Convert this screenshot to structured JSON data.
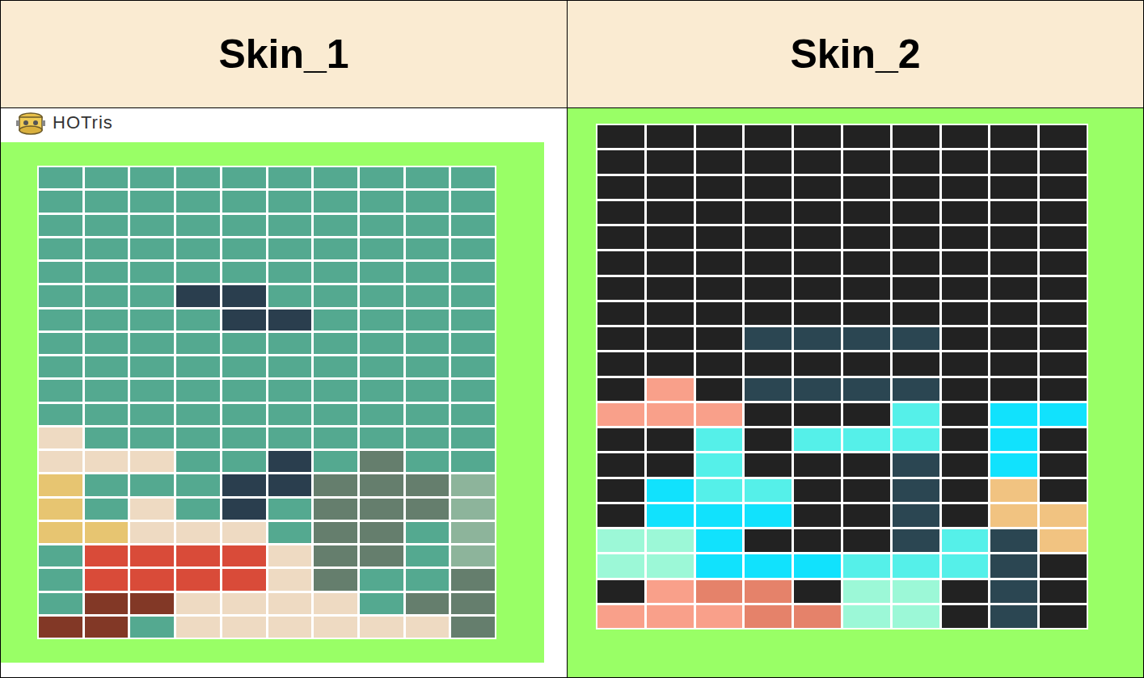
{
  "columns": [
    {
      "label": "Skin_1",
      "kind": "window",
      "window": {
        "title": "HOTris"
      },
      "board": {
        "rows": [
          [
            "#54a990",
            "#54a990",
            "#54a990",
            "#54a990",
            "#54a990",
            "#54a990",
            "#54a990",
            "#54a990",
            "#54a990",
            "#54a990"
          ],
          [
            "#54a990",
            "#54a990",
            "#54a990",
            "#54a990",
            "#54a990",
            "#54a990",
            "#54a990",
            "#54a990",
            "#54a990",
            "#54a990"
          ],
          [
            "#54a990",
            "#54a990",
            "#54a990",
            "#54a990",
            "#54a990",
            "#54a990",
            "#54a990",
            "#54a990",
            "#54a990",
            "#54a990"
          ],
          [
            "#54a990",
            "#54a990",
            "#54a990",
            "#54a990",
            "#54a990",
            "#54a990",
            "#54a990",
            "#54a990",
            "#54a990",
            "#54a990"
          ],
          [
            "#54a990",
            "#54a990",
            "#54a990",
            "#54a990",
            "#54a990",
            "#54a990",
            "#54a990",
            "#54a990",
            "#54a990",
            "#54a990"
          ],
          [
            "#54a990",
            "#54a990",
            "#54a990",
            "#2a3e4e",
            "#2a3e4e",
            "#54a990",
            "#54a990",
            "#54a990",
            "#54a990",
            "#54a990"
          ],
          [
            "#54a990",
            "#54a990",
            "#54a990",
            "#54a990",
            "#2a3e4e",
            "#2a3e4e",
            "#54a990",
            "#54a990",
            "#54a990",
            "#54a990"
          ],
          [
            "#54a990",
            "#54a990",
            "#54a990",
            "#54a990",
            "#54a990",
            "#54a990",
            "#54a990",
            "#54a990",
            "#54a990",
            "#54a990"
          ],
          [
            "#54a990",
            "#54a990",
            "#54a990",
            "#54a990",
            "#54a990",
            "#54a990",
            "#54a990",
            "#54a990",
            "#54a990",
            "#54a990"
          ],
          [
            "#54a990",
            "#54a990",
            "#54a990",
            "#54a990",
            "#54a990",
            "#54a990",
            "#54a990",
            "#54a990",
            "#54a990",
            "#54a990"
          ],
          [
            "#54a990",
            "#54a990",
            "#54a990",
            "#54a990",
            "#54a990",
            "#54a990",
            "#54a990",
            "#54a990",
            "#54a990",
            "#54a990"
          ],
          [
            "#eedac2",
            "#54a990",
            "#54a990",
            "#54a990",
            "#54a990",
            "#54a990",
            "#54a990",
            "#54a990",
            "#54a990",
            "#54a990"
          ],
          [
            "#eedac2",
            "#eedac2",
            "#eedac2",
            "#54a990",
            "#54a990",
            "#2a3e4e",
            "#54a990",
            "#657e6d",
            "#54a990",
            "#54a990"
          ],
          [
            "#e7c571",
            "#54a990",
            "#54a990",
            "#54a990",
            "#2a3e4e",
            "#2a3e4e",
            "#657e6d",
            "#657e6d",
            "#657e6d",
            "#8db49b"
          ],
          [
            "#e7c571",
            "#54a990",
            "#eedac2",
            "#54a990",
            "#2a3e4e",
            "#54a990",
            "#657e6d",
            "#657e6d",
            "#657e6d",
            "#8db49b"
          ],
          [
            "#e7c571",
            "#e7c571",
            "#eedac2",
            "#eedac2",
            "#eedac2",
            "#54a990",
            "#657e6d",
            "#657e6d",
            "#54a990",
            "#8db49b"
          ],
          [
            "#54a990",
            "#d94b39",
            "#d94b39",
            "#d94b39",
            "#d94b39",
            "#eedac2",
            "#657e6d",
            "#657e6d",
            "#54a990",
            "#8db49b"
          ],
          [
            "#54a990",
            "#d94b39",
            "#d94b39",
            "#d94b39",
            "#d94b39",
            "#eedac2",
            "#657e6d",
            "#54a990",
            "#54a990",
            "#657e6d"
          ],
          [
            "#54a990",
            "#823826",
            "#823826",
            "#eedac2",
            "#eedac2",
            "#eedac2",
            "#eedac2",
            "#54a990",
            "#657e6d",
            "#657e6d"
          ],
          [
            "#823826",
            "#823826",
            "#54a990",
            "#eedac2",
            "#eedac2",
            "#eedac2",
            "#eedac2",
            "#eedac2",
            "#eedac2",
            "#657e6d"
          ]
        ]
      }
    },
    {
      "label": "Skin_2",
      "kind": "plain",
      "board": {
        "rows": [
          [
            "#222222",
            "#222222",
            "#222222",
            "#222222",
            "#222222",
            "#222222",
            "#222222",
            "#222222",
            "#222222",
            "#222222"
          ],
          [
            "#222222",
            "#222222",
            "#222222",
            "#222222",
            "#222222",
            "#222222",
            "#222222",
            "#222222",
            "#222222",
            "#222222"
          ],
          [
            "#222222",
            "#222222",
            "#222222",
            "#222222",
            "#222222",
            "#222222",
            "#222222",
            "#222222",
            "#222222",
            "#222222"
          ],
          [
            "#222222",
            "#222222",
            "#222222",
            "#222222",
            "#222222",
            "#222222",
            "#222222",
            "#222222",
            "#222222",
            "#222222"
          ],
          [
            "#222222",
            "#222222",
            "#222222",
            "#222222",
            "#222222",
            "#222222",
            "#222222",
            "#222222",
            "#222222",
            "#222222"
          ],
          [
            "#222222",
            "#222222",
            "#222222",
            "#222222",
            "#222222",
            "#222222",
            "#222222",
            "#222222",
            "#222222",
            "#222222"
          ],
          [
            "#222222",
            "#222222",
            "#222222",
            "#222222",
            "#222222",
            "#222222",
            "#222222",
            "#222222",
            "#222222",
            "#222222"
          ],
          [
            "#222222",
            "#222222",
            "#222222",
            "#222222",
            "#222222",
            "#222222",
            "#222222",
            "#222222",
            "#222222",
            "#222222"
          ],
          [
            "#222222",
            "#222222",
            "#222222",
            "#2b4652",
            "#2b4652",
            "#2b4652",
            "#2b4652",
            "#222222",
            "#222222",
            "#222222"
          ],
          [
            "#222222",
            "#222222",
            "#222222",
            "#222222",
            "#222222",
            "#222222",
            "#222222",
            "#222222",
            "#222222",
            "#222222"
          ],
          [
            "#222222",
            "#f9a08a",
            "#222222",
            "#2b4652",
            "#2b4652",
            "#2b4652",
            "#2b4652",
            "#222222",
            "#222222",
            "#222222"
          ],
          [
            "#f9a08a",
            "#f9a08a",
            "#f9a08a",
            "#222222",
            "#222222",
            "#222222",
            "#55f0e9",
            "#222222",
            "#11e2fd",
            "#11e2fd"
          ],
          [
            "#222222",
            "#222222",
            "#55f0e9",
            "#222222",
            "#55f0e9",
            "#55f0e9",
            "#55f0e9",
            "#222222",
            "#11e2fd",
            "#222222"
          ],
          [
            "#222222",
            "#222222",
            "#55f0e9",
            "#222222",
            "#222222",
            "#222222",
            "#2b4652",
            "#222222",
            "#11e2fd",
            "#222222"
          ],
          [
            "#222222",
            "#11e2fd",
            "#55f0e9",
            "#55f0e9",
            "#222222",
            "#222222",
            "#2b4652",
            "#222222",
            "#f1c381",
            "#222222"
          ],
          [
            "#222222",
            "#11e2fd",
            "#11e2fd",
            "#11e2fd",
            "#222222",
            "#222222",
            "#2b4652",
            "#222222",
            "#f1c381",
            "#f1c381"
          ],
          [
            "#9cf8d7",
            "#9cf8d7",
            "#11e2fd",
            "#222222",
            "#222222",
            "#222222",
            "#2b4652",
            "#55f0e9",
            "#2b4652",
            "#f1c381"
          ],
          [
            "#9cf8d7",
            "#9cf8d7",
            "#11e2fd",
            "#11e2fd",
            "#11e2fd",
            "#55f0e9",
            "#55f0e9",
            "#55f0e9",
            "#2b4652",
            "#222222"
          ],
          [
            "#222222",
            "#f9a08a",
            "#e5826a",
            "#e5826a",
            "#222222",
            "#9cf8d7",
            "#9cf8d7",
            "#222222",
            "#2b4652",
            "#222222"
          ],
          [
            "#f9a08a",
            "#f9a08a",
            "#f9a08a",
            "#e5826a",
            "#e5826a",
            "#9cf8d7",
            "#9cf8d7",
            "#222222",
            "#2b4652",
            "#222222"
          ]
        ]
      }
    }
  ]
}
